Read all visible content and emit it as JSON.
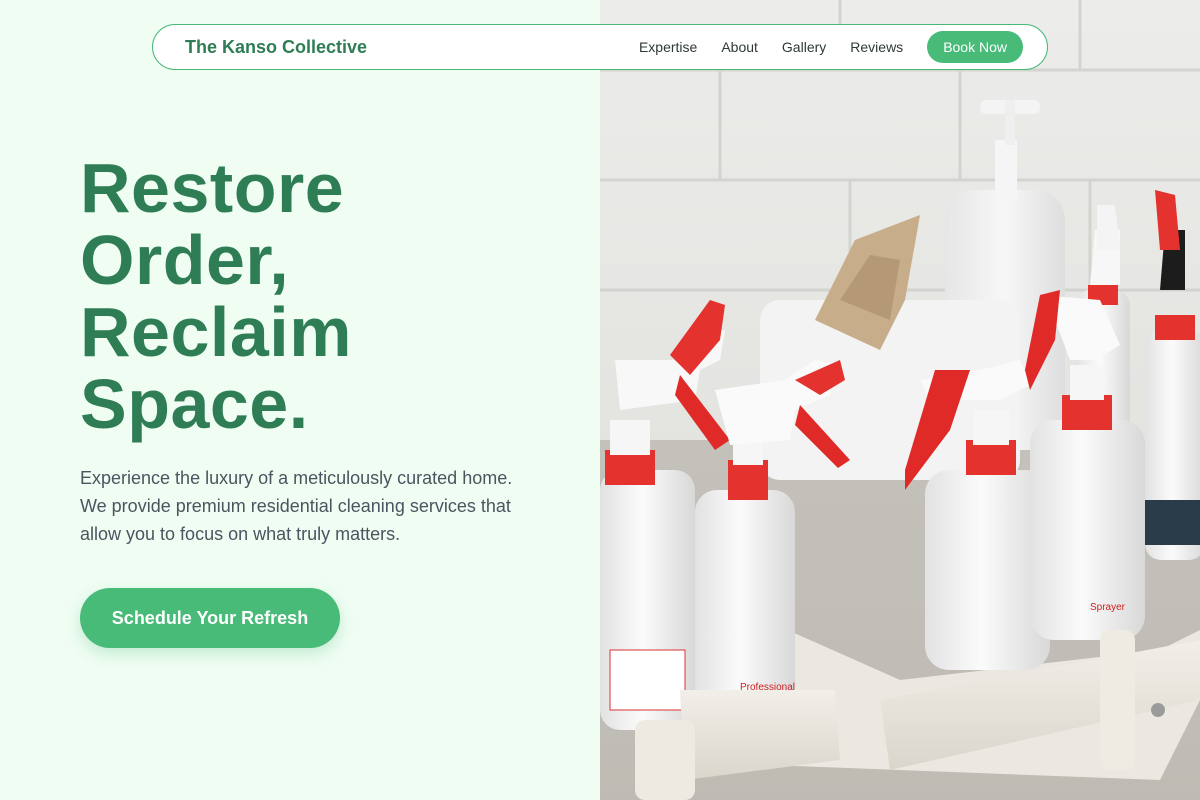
{
  "nav": {
    "brand": "The Kanso Collective",
    "links": [
      "Expertise",
      "About",
      "Gallery",
      "Reviews"
    ],
    "cta_label": "Book Now"
  },
  "hero": {
    "title_lines": [
      "Restore",
      "Order,",
      "Reclaim",
      "Space."
    ],
    "description": "Experience the luxury of a meticulously curated home. We provide premium residential cleaning services that allow you to focus on what truly matters.",
    "cta_label": "Schedule Your Refresh"
  },
  "image": {
    "bottle_labels": [
      "Professional",
      "Sprayer"
    ]
  },
  "colors": {
    "accent": "#48bb78",
    "heading": "#2e7d55",
    "background": "#effdf3",
    "text": "#4a5560"
  }
}
